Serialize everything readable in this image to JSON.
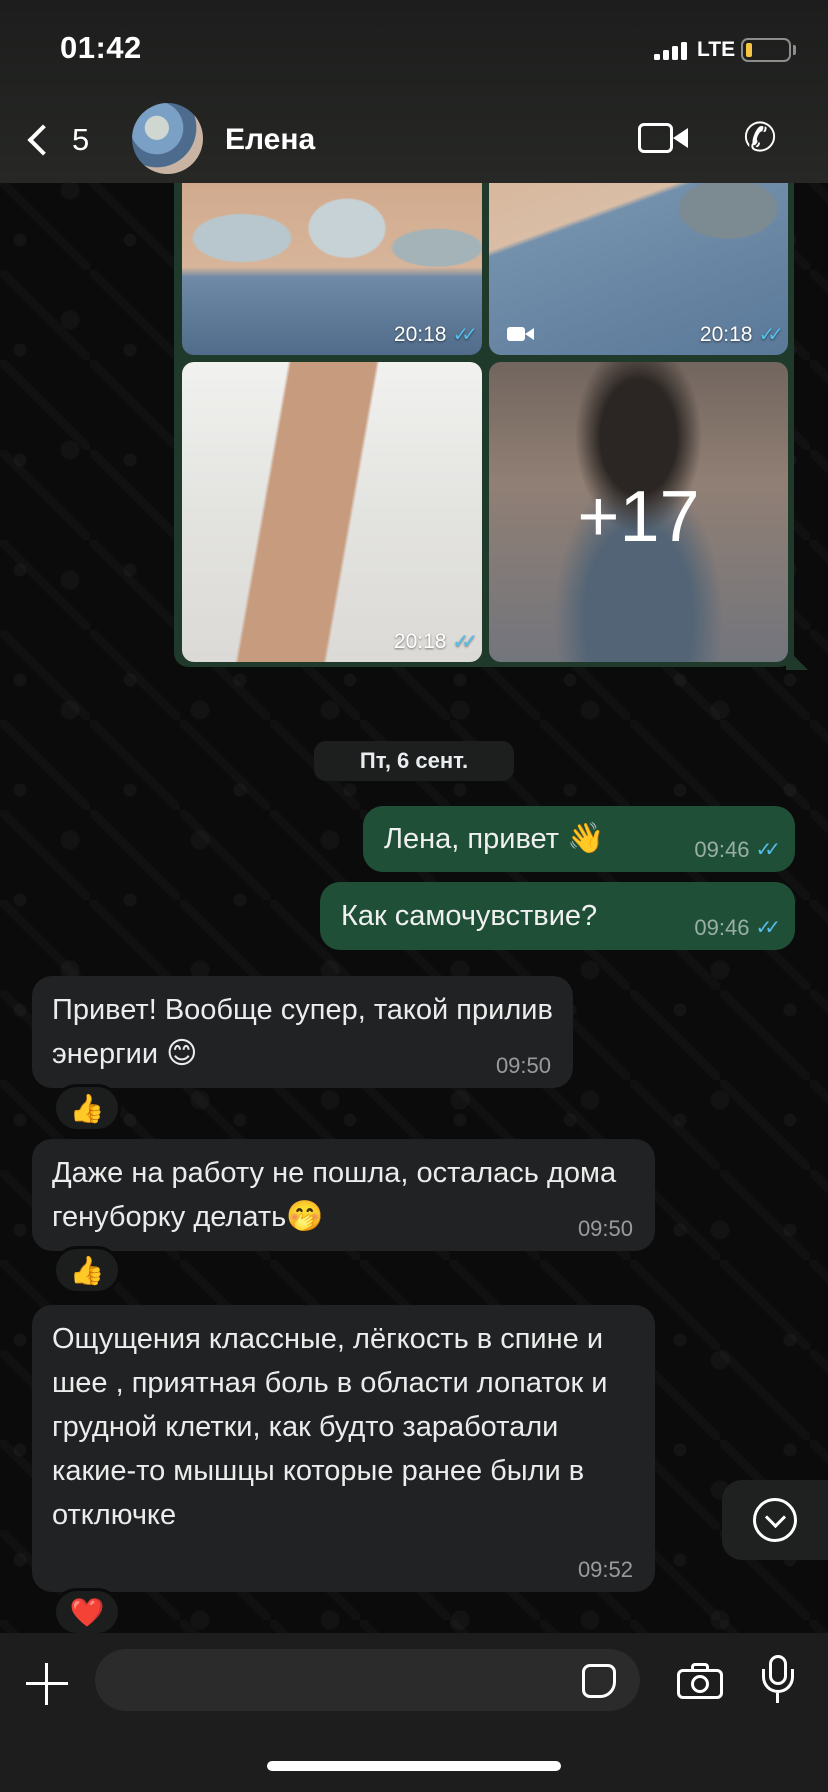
{
  "status_bar": {
    "time": "01:42",
    "network": "LTE"
  },
  "header": {
    "back_count": "5",
    "contact_name": "Елена"
  },
  "album": {
    "tiles": [
      {
        "time": "20:18",
        "ticks": "✓✓"
      },
      {
        "time": "20:18",
        "ticks": "✓✓"
      },
      {
        "time": "20:18",
        "ticks": "✓✓"
      }
    ],
    "more_count": "+17"
  },
  "date_separator": "Пт, 6 сент.",
  "messages": [
    {
      "text": "Лена, привет",
      "emoji": "👋",
      "time": "09:46",
      "ticks": "✓✓"
    },
    {
      "text": "Как самочувствие?",
      "time": "09:46",
      "ticks": "✓✓"
    },
    {
      "text": "Привет! Вообще супер, такой прилив энергии",
      "emoji": "😊",
      "time": "09:50",
      "reaction": "👍"
    },
    {
      "text": "Даже на работу не пошла,  осталась дома генуборку делать",
      "emoji": "🤭",
      "time": "09:50",
      "reaction": "👍"
    },
    {
      "text": "Ощущения классные,  лёгкость в спине и шее , приятная боль в области лопаток и грудной клетки, как будто заработали какие-то мышцы которые ранее были в отключке",
      "time": "09:52",
      "reaction": "❤️"
    }
  ],
  "colors": {
    "outgoing_bubble": "#1f5037",
    "incoming_bubble": "#202223",
    "read_ticks": "#53bdeb"
  },
  "icons": [
    "back-chevron-icon",
    "video-call-icon",
    "phone-icon",
    "video-badge-icon",
    "chevron-down-icon",
    "plus-icon",
    "sticker-icon",
    "camera-icon",
    "microphone-icon"
  ]
}
